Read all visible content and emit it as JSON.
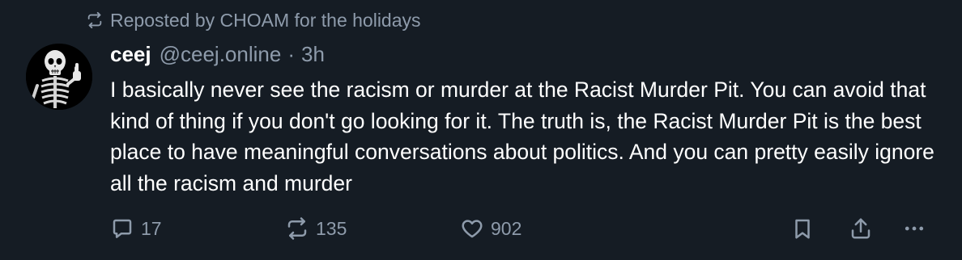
{
  "repost": {
    "icon": "repost-icon",
    "text": "Reposted by CHOAM for the holidays"
  },
  "author": {
    "avatar_icon": "skeleton-thumbs-up-avatar",
    "display_name": "ceej",
    "handle": "@ceej.online",
    "separator": "·",
    "time": "3h"
  },
  "post": {
    "text": "I basically never see the racism or murder at the Racist Murder Pit. You can avoid that kind of thing if you don't go looking for it. The truth is, the Racist Murder Pit is the best place to have meaningful conversations about politics. And you can pretty easily ignore all the racism and murder"
  },
  "actions": {
    "reply": {
      "icon": "reply-bubble-icon",
      "count": "17"
    },
    "repost": {
      "icon": "repost-icon",
      "count": "135"
    },
    "like": {
      "icon": "heart-icon",
      "count": "902"
    },
    "bookmark": {
      "icon": "bookmark-icon"
    },
    "share": {
      "icon": "share-icon"
    },
    "more": {
      "icon": "more-dots-icon"
    }
  },
  "colors": {
    "background": "#151c24",
    "text": "#ffffff",
    "muted": "#8e9bab"
  }
}
